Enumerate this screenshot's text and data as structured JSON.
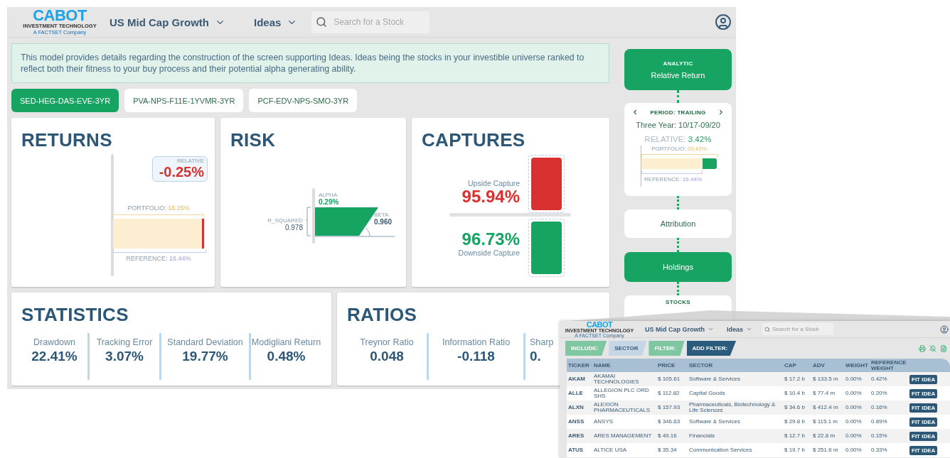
{
  "header": {
    "logo": "CABOT",
    "logo_sub": "INVESTMENT TECHNOLOGY",
    "logo_tag": "A FACTSET Company",
    "model": "US Mid Cap Growth",
    "view": "Ideas",
    "search": {
      "placeholder": "Search for a Stock"
    }
  },
  "info": "This model provides details regarding the construction of the screen supporting Ideas. Ideas being the stocks in your investible universe ranked to reflect both their fitness to your buy process and their potential alpha generating ability.",
  "tabs": [
    {
      "label": "SED-HEG-DAS-EVE-3YR",
      "selected": true
    },
    {
      "label": "PVA-NPS-F11E-1YVMR-3YR",
      "selected": false
    },
    {
      "label": "PCF-EDV-NPS-SMO-3YR",
      "selected": false
    }
  ],
  "returns": {
    "title": "RETURNS",
    "relative_label": "RELATIVE",
    "relative": "-0.25%",
    "portfolio_label": "PORTFOLIO:",
    "portfolio": "16.15%",
    "reference_label": "REFERENCE:",
    "reference": "16.44%"
  },
  "risk": {
    "title": "RISK",
    "alpha_label": "ALPHA",
    "alpha": "0.29%",
    "beta_label": "BETA",
    "beta": "0.960",
    "r2_label": "R_SQUARED",
    "r2": "0.978"
  },
  "captures": {
    "title": "CAPTURES",
    "upside_label": "Upside Capture",
    "upside": "95.94%",
    "downside": "96.73%",
    "downside_label": "Downside Capture"
  },
  "statistics": {
    "title": "STATISTICS",
    "items": [
      {
        "label": "Drawdown",
        "value": "22.41%"
      },
      {
        "label": "Tracking Error",
        "value": "3.07%"
      },
      {
        "label": "Standard Deviation",
        "value": "19.77%"
      },
      {
        "label": "Modigliani Return",
        "value": "0.48%"
      }
    ]
  },
  "ratios": {
    "title": "RATIOS",
    "items": [
      {
        "label": "Treynor Ratio",
        "value": "0.048"
      },
      {
        "label": "Information Ratio",
        "value": "-0.118"
      },
      {
        "label": "Sharp",
        "value": "0."
      }
    ]
  },
  "steps": [
    {
      "kind": "choice",
      "caption": "ANALYTIC",
      "label": "Relative Return",
      "selected": true
    },
    {
      "kind": "period",
      "caption": "PERIOD: TRAILING",
      "range": "Three Year: 10/17-09/20",
      "relative_label": "RELATIVE:",
      "relative": "3.42%",
      "portfolio_label": "PORTFOLIO:",
      "portfolio": "20.43%",
      "reference_label": "REFERENCE:",
      "reference": "16.44%"
    },
    {
      "kind": "choice",
      "label": "Attribution",
      "selected": false
    },
    {
      "kind": "choice",
      "label": "Holdings",
      "selected": true
    },
    {
      "kind": "choice",
      "caption": "STOCKS",
      "selected": false
    }
  ],
  "inset": {
    "header": {
      "logo": "CABOT",
      "logo_sub": "INVESTMENT TECHNOLOGY",
      "logo_tag": "A FACTSET Company",
      "model": "US Mid Cap Growth",
      "view": "Ideas",
      "search": {
        "placeholder": "Search for a Stock"
      }
    },
    "filters": [
      {
        "kind": "include",
        "label": "INCLUDE:"
      },
      {
        "kind": "tag",
        "label": "SECTOR"
      },
      {
        "kind": "include",
        "label": "FILTER:"
      },
      {
        "kind": "add",
        "label": "ADD FILTER:"
      }
    ],
    "columns": [
      "TICKER",
      "NAME",
      "PRICE",
      "SECTOR",
      "CAP",
      "ADV",
      "WEIGHT",
      "REFERENCE WEIGHT"
    ],
    "rows": [
      {
        "ticker": "AKAM",
        "name": "AKAMAI TECHNOLOGIES",
        "price": "$ 105.61",
        "sector": "Software & Services",
        "cap": "$ 17.2 b",
        "adv": "$ 133.5 m",
        "weight": "0.00%",
        "reference_weight": "0.42%",
        "action": "FIT IDEA"
      },
      {
        "ticker": "ALLE",
        "name": "ALLEGION PLC ORD SHS",
        "price": "$ 112.82",
        "sector": "Capital Goods",
        "cap": "$ 10.4 b",
        "adv": "$ 77.4 m",
        "weight": "0.00%",
        "reference_weight": "0.20%",
        "action": "FIT IDEA"
      },
      {
        "ticker": "ALXN",
        "name": "ALEXION PHARMACEUTICALS",
        "price": "$ 157.93",
        "sector": "Pharmaceuticals, Biotechnology & Life Sciences",
        "cap": "$ 34.6 b",
        "adv": "$ 412.4 m",
        "weight": "0.00%",
        "reference_weight": "0.16%",
        "action": "FIT IDEA"
      },
      {
        "ticker": "ANSS",
        "name": "ANSYS",
        "price": "$ 346.63",
        "sector": "Software & Services",
        "cap": "$ 29.8 b",
        "adv": "$ 115.1 m",
        "weight": "0.00%",
        "reference_weight": "0.89%",
        "action": "FIT IDEA"
      },
      {
        "ticker": "ARES",
        "name": "ARES MANAGEMENT",
        "price": "$ 49.16",
        "sector": "Financials",
        "cap": "$ 12.7 b",
        "adv": "$ 22.8 m",
        "weight": "0.00%",
        "reference_weight": "0.15%",
        "action": "FIT IDEA"
      },
      {
        "ticker": "ATUS",
        "name": "ALTICE USA",
        "price": "$ 35.34",
        "sector": "Communication Services",
        "cap": "$ 19.7 b",
        "adv": "$ 251.6 m",
        "weight": "0.00%",
        "reference_weight": "0.33%",
        "action": "FIT IDEA"
      }
    ]
  }
}
